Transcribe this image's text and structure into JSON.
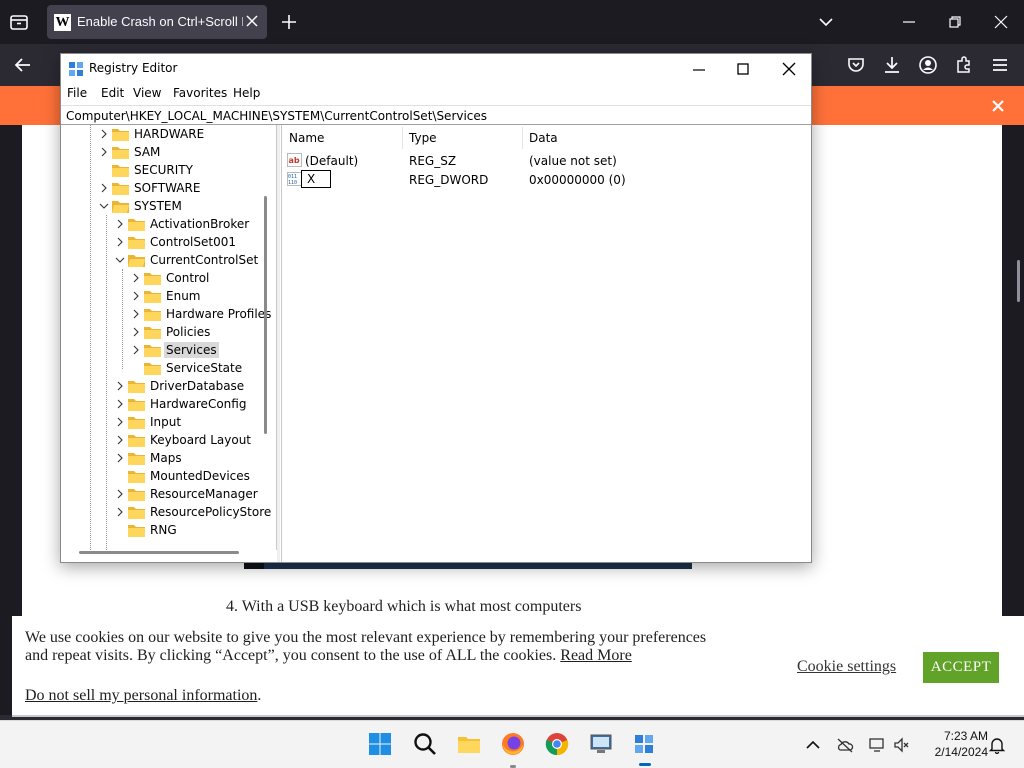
{
  "browser": {
    "tab_title": "Enable Crash on Ctrl+Scroll Lock",
    "tab_favicon": "W",
    "theme": {
      "chrome_bg": "#1c1b22",
      "tab_bg": "#42414d",
      "notif_bg": "#ff7139"
    }
  },
  "regedit": {
    "title": "Registry Editor",
    "menu": [
      "File",
      "Edit",
      "View",
      "Favorites",
      "Help"
    ],
    "address": "Computer\\HKEY_LOCAL_MACHINE\\SYSTEM\\CurrentControlSet\\Services",
    "tree": [
      {
        "label": "HARDWARE",
        "expand": "collapsed"
      },
      {
        "label": "SAM",
        "expand": "collapsed"
      },
      {
        "label": "SECURITY",
        "expand": "none"
      },
      {
        "label": "SOFTWARE",
        "expand": "collapsed"
      },
      {
        "label": "SYSTEM",
        "expand": "expanded"
      },
      {
        "label": "ActivationBroker",
        "expand": "collapsed"
      },
      {
        "label": "ControlSet001",
        "expand": "collapsed"
      },
      {
        "label": "CurrentControlSet",
        "expand": "expanded"
      },
      {
        "label": "Control",
        "expand": "collapsed"
      },
      {
        "label": "Enum",
        "expand": "collapsed"
      },
      {
        "label": "Hardware Profiles",
        "expand": "collapsed"
      },
      {
        "label": "Policies",
        "expand": "collapsed"
      },
      {
        "label": "Services",
        "expand": "collapsed",
        "selected": true
      },
      {
        "label": "ServiceState",
        "expand": "none"
      },
      {
        "label": "DriverDatabase",
        "expand": "collapsed"
      },
      {
        "label": "HardwareConfig",
        "expand": "collapsed"
      },
      {
        "label": "Input",
        "expand": "collapsed"
      },
      {
        "label": "Keyboard Layout",
        "expand": "collapsed"
      },
      {
        "label": "Maps",
        "expand": "collapsed"
      },
      {
        "label": "MountedDevices",
        "expand": "none"
      },
      {
        "label": "ResourceManager",
        "expand": "collapsed"
      },
      {
        "label": "ResourcePolicyStore",
        "expand": "collapsed"
      },
      {
        "label": "RNG",
        "expand": "none"
      }
    ],
    "columns": {
      "name": "Name",
      "type": "Type",
      "data": "Data"
    },
    "values": [
      {
        "name": "(Default)",
        "type": "REG_SZ",
        "data": "(value not set)",
        "icon": "string-value-icon"
      },
      {
        "name": "X",
        "type": "REG_DWORD",
        "data": "0x00000000 (0)",
        "icon": "dword-value-icon",
        "renaming": true
      }
    ]
  },
  "page": {
    "step_text": "4. With a USB keyboard which is what most computers"
  },
  "cookie": {
    "text": "We use cookies on our website to give you the most relevant experience by remembering your preferences and repeat visits. By clicking “Accept”, you consent to the use of ALL the cookies.",
    "read_more": "Read More",
    "do_not_sell": "Do not sell my personal information",
    "do_not_sell_suffix": ".",
    "settings": "Cookie settings",
    "accept": "ACCEPT",
    "accept_color": "#61a229"
  },
  "taskbar": {
    "apps": [
      "windows-start-icon",
      "search-icon",
      "file-explorer-icon",
      "firefox-icon",
      "chrome-icon",
      "remote-desktop-icon",
      "regedit-icon"
    ],
    "time": "7:23 AM",
    "date": "2/14/2024"
  }
}
